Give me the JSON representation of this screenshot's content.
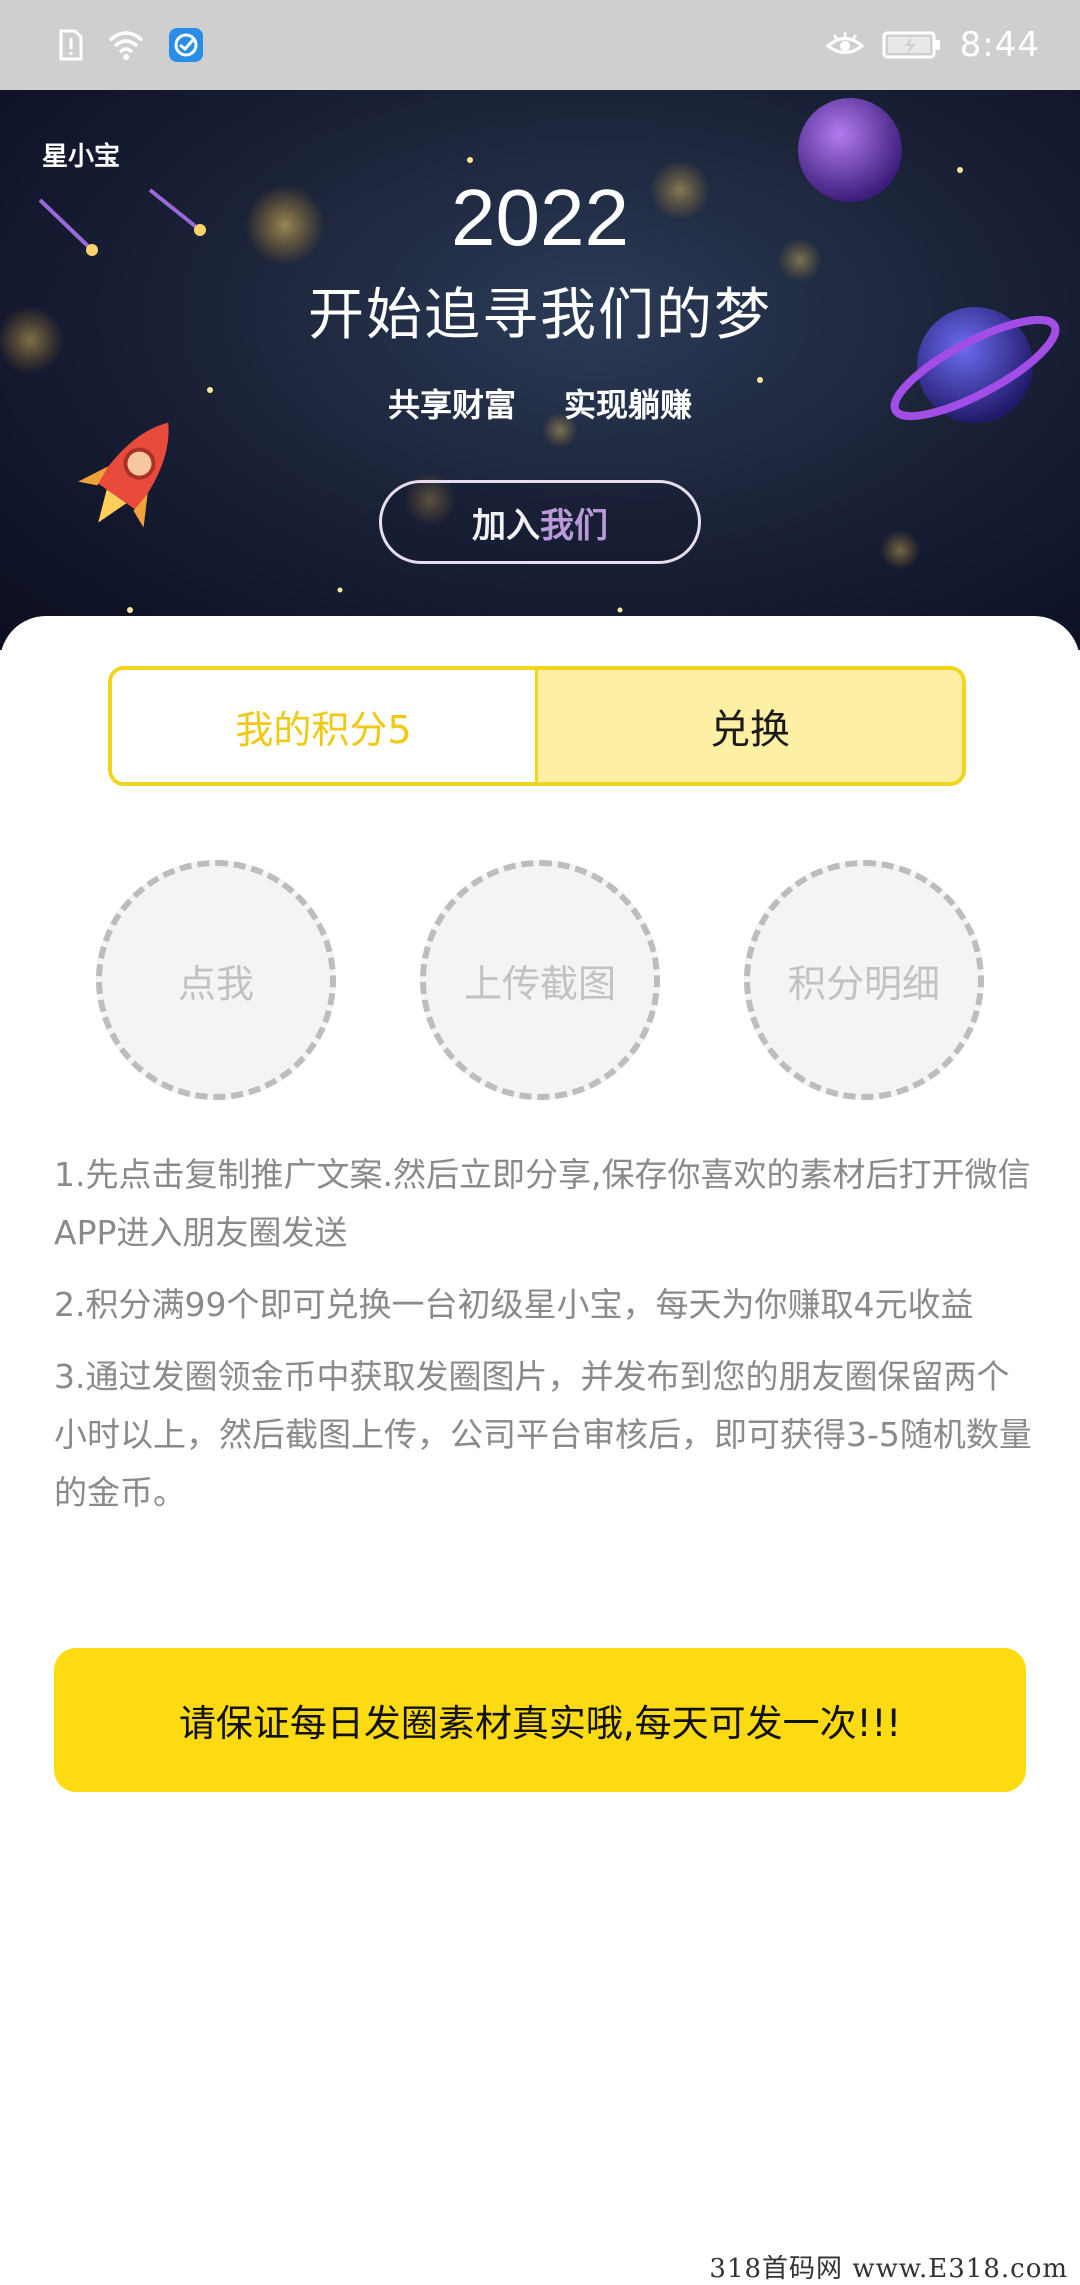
{
  "status_bar": {
    "time": "8:44",
    "left_icons": [
      "sim-alert-icon",
      "wifi-icon",
      "app-notification-icon"
    ],
    "right_icons": [
      "eye-icon",
      "battery-charging-icon"
    ]
  },
  "banner": {
    "brand": "星小宝",
    "year": "2022",
    "title": "开始追寻我们的梦",
    "tags": [
      "共享财富",
      "实现躺赚"
    ],
    "join_button": {
      "part1": "加入",
      "part2": "我们"
    }
  },
  "score": {
    "label": "我的积分5",
    "exchange": "兑换",
    "colors": {
      "accent": "#f2d51b",
      "text": "#f0c912",
      "exchange_bg": "#fdf0a5"
    }
  },
  "actions": [
    {
      "label": "点我"
    },
    {
      "label": "上传截图"
    },
    {
      "label": "积分明细"
    }
  ],
  "rules": [
    "1.先点击复制推广文案.然后立即分享,保存你喜欢的素材后打开微信APP进入朋友圈发送",
    "2.积分满99个即可兑换一台初级星小宝，每天为你赚取4元收益",
    "3.通过发圈领金币中获取发圈图片，并发布到您的朋友圈保留两个小时以上，然后截图上传，公司平台审核后，即可获得3-5随机数量的金币。"
  ],
  "notice": "请保证每日发圈素材真实哦,每天可发一次!!!",
  "watermark": "318首码网 www.E318.com"
}
